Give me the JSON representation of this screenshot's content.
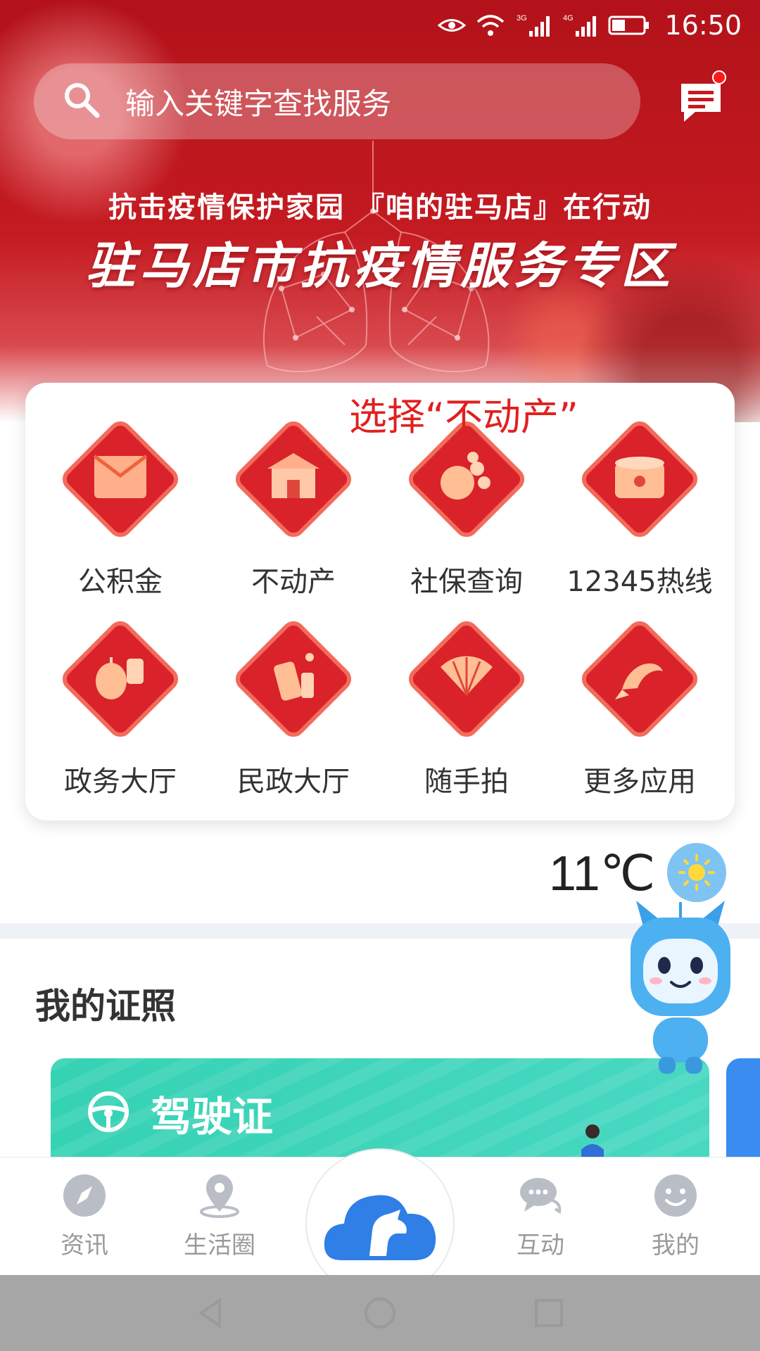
{
  "status_bar": {
    "time": "16:50",
    "net_1": "3G",
    "net_2": "4G",
    "icons": [
      "eye-comfort-icon",
      "wifi-icon",
      "signal-icon",
      "battery-icon"
    ]
  },
  "search": {
    "placeholder": "输入关键字查找服务"
  },
  "banner": {
    "subtitle": "抗击疫情保护家园 『咱的驻马店』在行动",
    "title": "驻马店市抗疫情服务专区"
  },
  "annotation": "选择“不动产”",
  "services": [
    {
      "label": "公积金",
      "icon": "red-envelope-icon"
    },
    {
      "label": "不动产",
      "icon": "house-icon"
    },
    {
      "label": "社保查询",
      "icon": "fruit-icon"
    },
    {
      "label": "12345热线",
      "icon": "drum-icon"
    },
    {
      "label": "政务大厅",
      "icon": "lantern-icon"
    },
    {
      "label": "民政大厅",
      "icon": "firecracker-icon"
    },
    {
      "label": "随手拍",
      "icon": "fan-icon"
    },
    {
      "label": "更多应用",
      "icon": "koi-icon"
    }
  ],
  "weather": {
    "temperature": "11℃",
    "icon": "sun-icon"
  },
  "licenses": {
    "section_title": "我的证照",
    "card_label": "驾驶证",
    "card_icon": "steering-wheel-icon"
  },
  "tabbar": {
    "tabs": [
      {
        "label": "资讯",
        "icon": "compass-icon"
      },
      {
        "label": "生活圈",
        "icon": "location-pin-icon"
      },
      {
        "label": "",
        "icon": "cloud-horse-logo-icon"
      },
      {
        "label": "互动",
        "icon": "chat-bubbles-icon"
      },
      {
        "label": "我的",
        "icon": "smiley-icon"
      }
    ]
  },
  "colors": {
    "banner_red": "#c41a21",
    "annotation_red": "#e02020",
    "license_teal": "#36d2b4",
    "brand_blue": "#2f7fe6"
  }
}
